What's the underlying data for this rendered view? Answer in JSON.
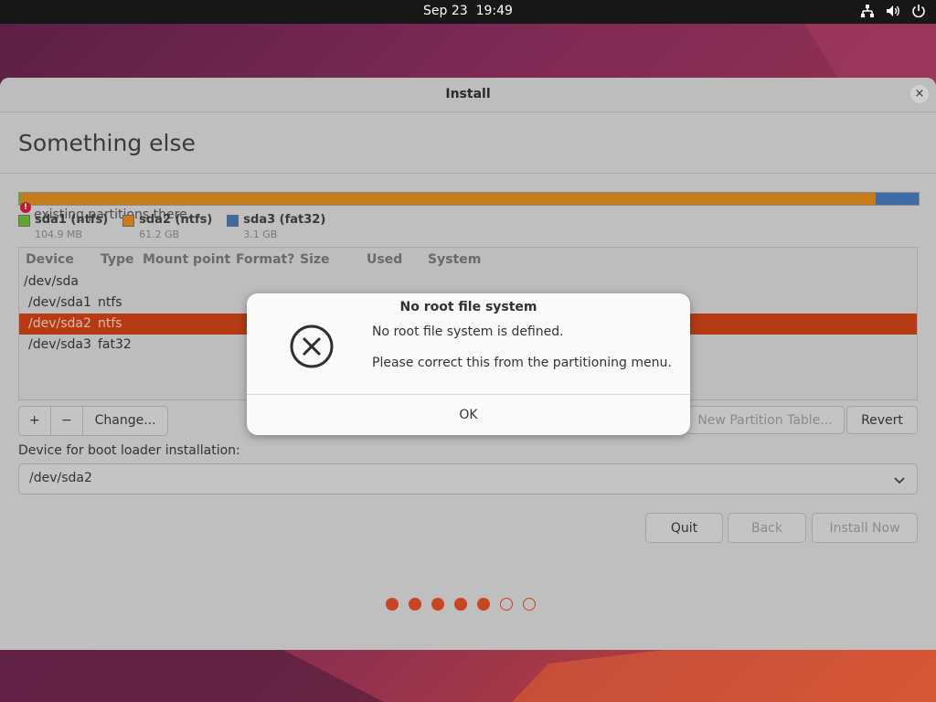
{
  "topbar": {
    "date": "Sep 23",
    "time": "19:49",
    "icons": [
      "network-icon",
      "volume-icon",
      "power-icon"
    ]
  },
  "window": {
    "title": "Install",
    "close_symbol": "×"
  },
  "page": {
    "heading": "Something else"
  },
  "warning": {
    "text": "existing partitions there.",
    "color": "#c7162b"
  },
  "partition_bar": {
    "segments": [
      {
        "name": "sda1",
        "fraction": 0.0017,
        "color": "#5fa82a"
      },
      {
        "name": "sda2",
        "fraction": 0.9505,
        "color": "#c77c1c"
      },
      {
        "name": "sda3",
        "fraction": 0.0478,
        "color": "#3e6aa6"
      }
    ]
  },
  "legend": [
    {
      "name": "sda1 (ntfs)",
      "size": "104.9 MB",
      "color": "#5fa82a"
    },
    {
      "name": "sda2 (ntfs)",
      "size": "61.2 GB",
      "color": "#d27a1a"
    },
    {
      "name": "sda3 (fat32)",
      "size": "3.1 GB",
      "color": "#3e6aa6"
    }
  ],
  "table": {
    "columns": [
      "Device",
      "Type",
      "Mount point",
      "Format?",
      "Size",
      "Used",
      "System"
    ],
    "rows": [
      {
        "device": "/dev/sda",
        "type": ""
      },
      {
        "device": "/dev/sda1",
        "type": "ntfs"
      },
      {
        "device": "/dev/sda2",
        "type": "ntfs",
        "selected": true
      },
      {
        "device": "/dev/sda3",
        "type": "fat32"
      }
    ]
  },
  "toolbar": {
    "add": "+",
    "remove": "−",
    "change": "Change...",
    "new_table": "New Partition Table...",
    "revert": "Revert"
  },
  "bootloader": {
    "label": "Device for boot loader installation:",
    "value": "/dev/sda2"
  },
  "nav": {
    "quit": "Quit",
    "back": "Back",
    "install": "Install Now"
  },
  "progress": {
    "total": 7,
    "completed": 5,
    "accent": "#c8451f"
  },
  "dialog": {
    "title": "No root file system",
    "message": "No root file system is defined.",
    "detail": "Please correct this from the partitioning menu.",
    "ok": "OK",
    "icon": "error-circle-x-icon"
  }
}
